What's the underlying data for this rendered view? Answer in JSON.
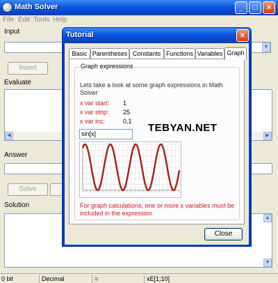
{
  "app": {
    "title": "Math Solver",
    "menu": [
      "File",
      "Edit",
      "Tools",
      "Help"
    ],
    "window_buttons": {
      "minimize": "_",
      "maximize": "□",
      "close": "×"
    }
  },
  "main": {
    "input_label": "Input",
    "insert_button": "Insert",
    "evaluate_label": "Evaluate",
    "answer_label": "Answer",
    "solve_button": "Solve",
    "solution_label": "Solution",
    "status": {
      "bits": "0 bit",
      "mode": "Decimal",
      "operator": "=",
      "range": "xE[1;10]"
    }
  },
  "dialog": {
    "title": "Tutorial",
    "tabs": [
      "Basic",
      "Parentheses",
      "Constants",
      "Functions",
      "Variables",
      "Graph"
    ],
    "active_tab": "Graph",
    "group_title": "Graph expressions",
    "intro": "Lets take a look at some graph expressions in Math Solver",
    "params": [
      {
        "label": "x var start:",
        "value": "1"
      },
      {
        "label": "x var stop:",
        "value": "25"
      },
      {
        "label": "x var inc:",
        "value": "0,1"
      }
    ],
    "expression": "sin[x]",
    "watermark": "TEBYAN.NET",
    "note": "For graph calculations, one or more x variables must be included in the expression",
    "close_button": "Close"
  },
  "chart_data": {
    "type": "line",
    "function": "sin[x]",
    "x_start": 1,
    "x_stop": 25,
    "x_inc": 0.1,
    "ylim": [
      -1,
      1
    ],
    "grid": true,
    "series_color": "#a81c1c"
  },
  "colors": {
    "title_bar": "#0a56e0",
    "series": "#a81c1c",
    "note_text": "#d21b1b",
    "active_tab_highlight": "#f0b23c"
  }
}
